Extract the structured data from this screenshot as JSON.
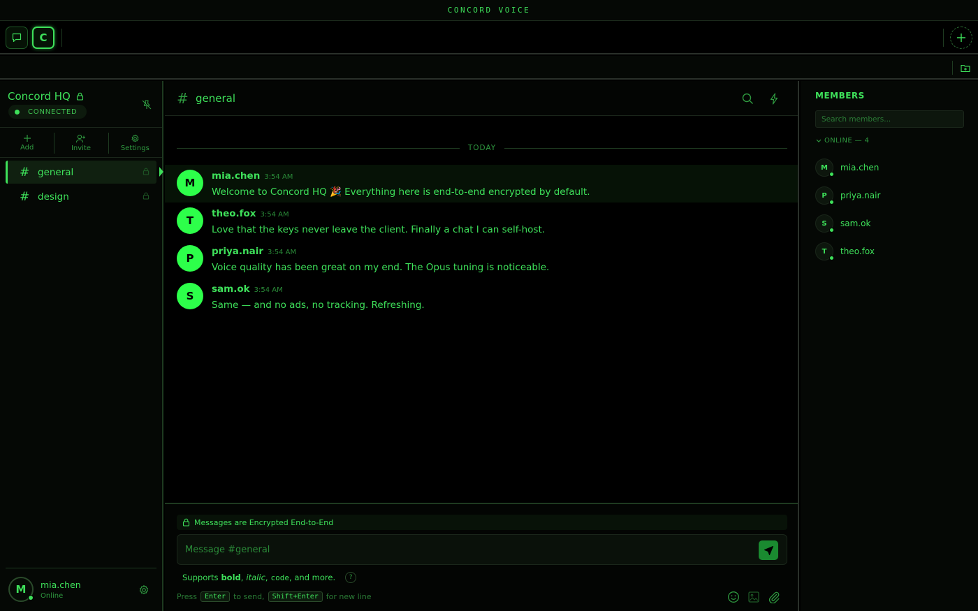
{
  "app": {
    "title": "CONCORD VOICE"
  },
  "server": {
    "name": "Concord HQ",
    "status": "CONNECTED",
    "server_initial": "C"
  },
  "sidebar": {
    "actions": [
      {
        "label": "Add",
        "icon": "plus-icon"
      },
      {
        "label": "Invite",
        "icon": "user-plus-icon"
      },
      {
        "label": "Settings",
        "icon": "gear-icon"
      }
    ],
    "channels": [
      {
        "name": "general",
        "active": true
      },
      {
        "name": "design",
        "active": false
      }
    ]
  },
  "user": {
    "initial": "M",
    "name": "mia.chen",
    "status": "Online"
  },
  "chat": {
    "channel": "general",
    "date_divider": "TODAY",
    "messages": [
      {
        "initial": "M",
        "author": "mia.chen",
        "time": "3:54 AM",
        "text": "Welcome to Concord HQ 🎉 Everything here is end-to-end encrypted by default."
      },
      {
        "initial": "T",
        "author": "theo.fox",
        "time": "3:54 AM",
        "text": "Love that the keys never leave the client. Finally a chat I can self-host."
      },
      {
        "initial": "P",
        "author": "priya.nair",
        "time": "3:54 AM",
        "text": "Voice quality has been great on my end. The Opus tuning is noticeable."
      },
      {
        "initial": "S",
        "author": "sam.ok",
        "time": "3:54 AM",
        "text": "Same — and no ads, no tracking. Refreshing."
      }
    ]
  },
  "composer": {
    "e2e_notice": "Messages are Encrypted End-to-End",
    "placeholder": "Message #general",
    "supports_prefix": "Supports",
    "fmt_bold": "bold",
    "fmt_sep1": ",",
    "fmt_italic": "italic",
    "fmt_sep2": ",",
    "fmt_code": "code",
    "fmt_suffix": ", and more.",
    "help_glyph": "?",
    "press": "Press",
    "key_enter": "Enter",
    "to_send": "to send,",
    "key_shift_enter": "Shift+Enter",
    "new_line": "for new line"
  },
  "members": {
    "title": "MEMBERS",
    "search_placeholder": "Search members...",
    "group_label": "ONLINE — 4",
    "list": [
      {
        "initial": "M",
        "name": "mia.chen"
      },
      {
        "initial": "P",
        "name": "priya.nair"
      },
      {
        "initial": "S",
        "name": "sam.ok"
      },
      {
        "initial": "T",
        "name": "theo.fox"
      }
    ]
  },
  "colors": {
    "accent": "#3ee05a",
    "avatar": "#2dff4a",
    "background": "#000000",
    "send": "#1a8a30"
  }
}
